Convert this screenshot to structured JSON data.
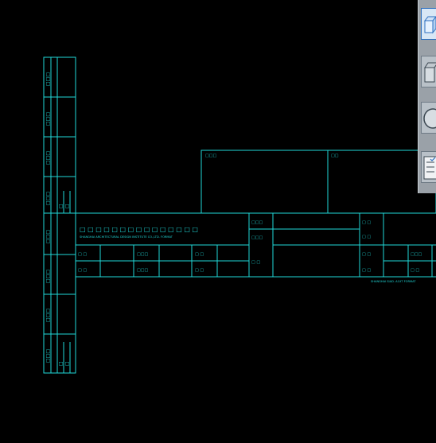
{
  "drawing": {
    "left_strip": {
      "labels": [
        "□□□",
        "□□□",
        "□□□",
        "□□□",
        "□□□",
        "□□□",
        "□□□",
        "□□□"
      ],
      "pair_labels": [
        "□",
        "□",
        "□",
        "□"
      ]
    },
    "upper_boxes": {
      "left_label": "□□□",
      "right_label": "□□"
    },
    "title_block": {
      "company_cn": "□ □ □ □ □ □ □ □ □ □ □ □ □ □ □",
      "company_en": "SHANGHAI ARCHITECTURAL DESIGN INSTITUTE CO.,LTD. FORMAT",
      "row1": [
        "□ □",
        "□□□",
        "□ □"
      ],
      "row2": [
        "□ □",
        "□□□",
        "□ □"
      ],
      "center_labels": [
        "□□□",
        "□□□",
        "□ □"
      ],
      "right_labels": [
        "□ □",
        "□ □",
        "□ □",
        "□ □",
        "□□□",
        "□ □"
      ],
      "footer_note": "SHANGHAI SIAD. A1XT FORMAT"
    }
  },
  "toolbar": {
    "buttons": [
      {
        "name": "box-tool",
        "icon": "box-3d-icon"
      },
      {
        "name": "wedge-tool",
        "icon": "wedge-3d-icon"
      },
      {
        "name": "cylinder-tool",
        "icon": "cylinder-icon"
      },
      {
        "name": "properties-tool",
        "icon": "properties-list-icon"
      }
    ]
  },
  "colors": {
    "background": "#000000",
    "lines": "#20d8d8",
    "palette": "#9aa1a8"
  }
}
